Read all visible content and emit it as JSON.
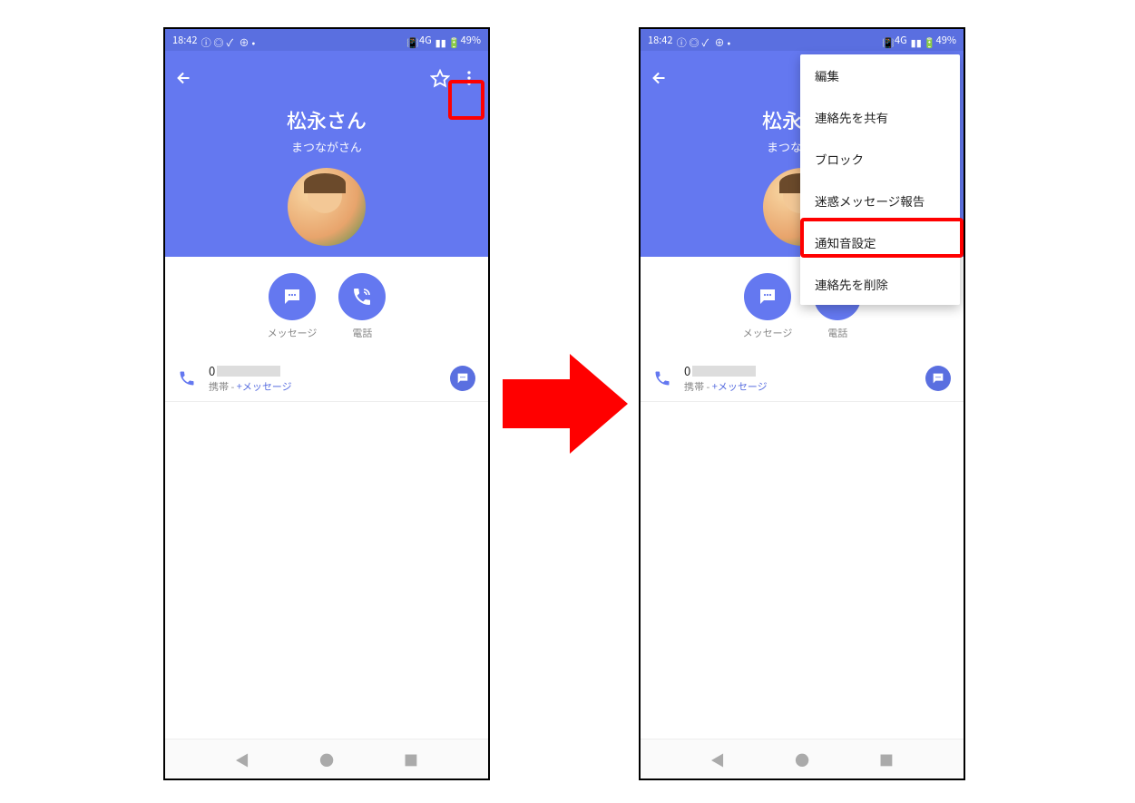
{
  "statusbar": {
    "time": "18:42",
    "network": "4G",
    "battery": "49%"
  },
  "contact": {
    "name": "松永さん",
    "furigana": "まつながさん",
    "actions": {
      "message": "メッセージ",
      "call": "電話"
    },
    "phone_row": {
      "num_prefix": "0",
      "sub_carrier": "携帯 - ",
      "sub_app": "+メッセージ"
    }
  },
  "menu": {
    "items": [
      "編集",
      "連絡先を共有",
      "ブロック",
      "迷惑メッセージ報告",
      "通知音設定",
      "連絡先を削除"
    ]
  }
}
